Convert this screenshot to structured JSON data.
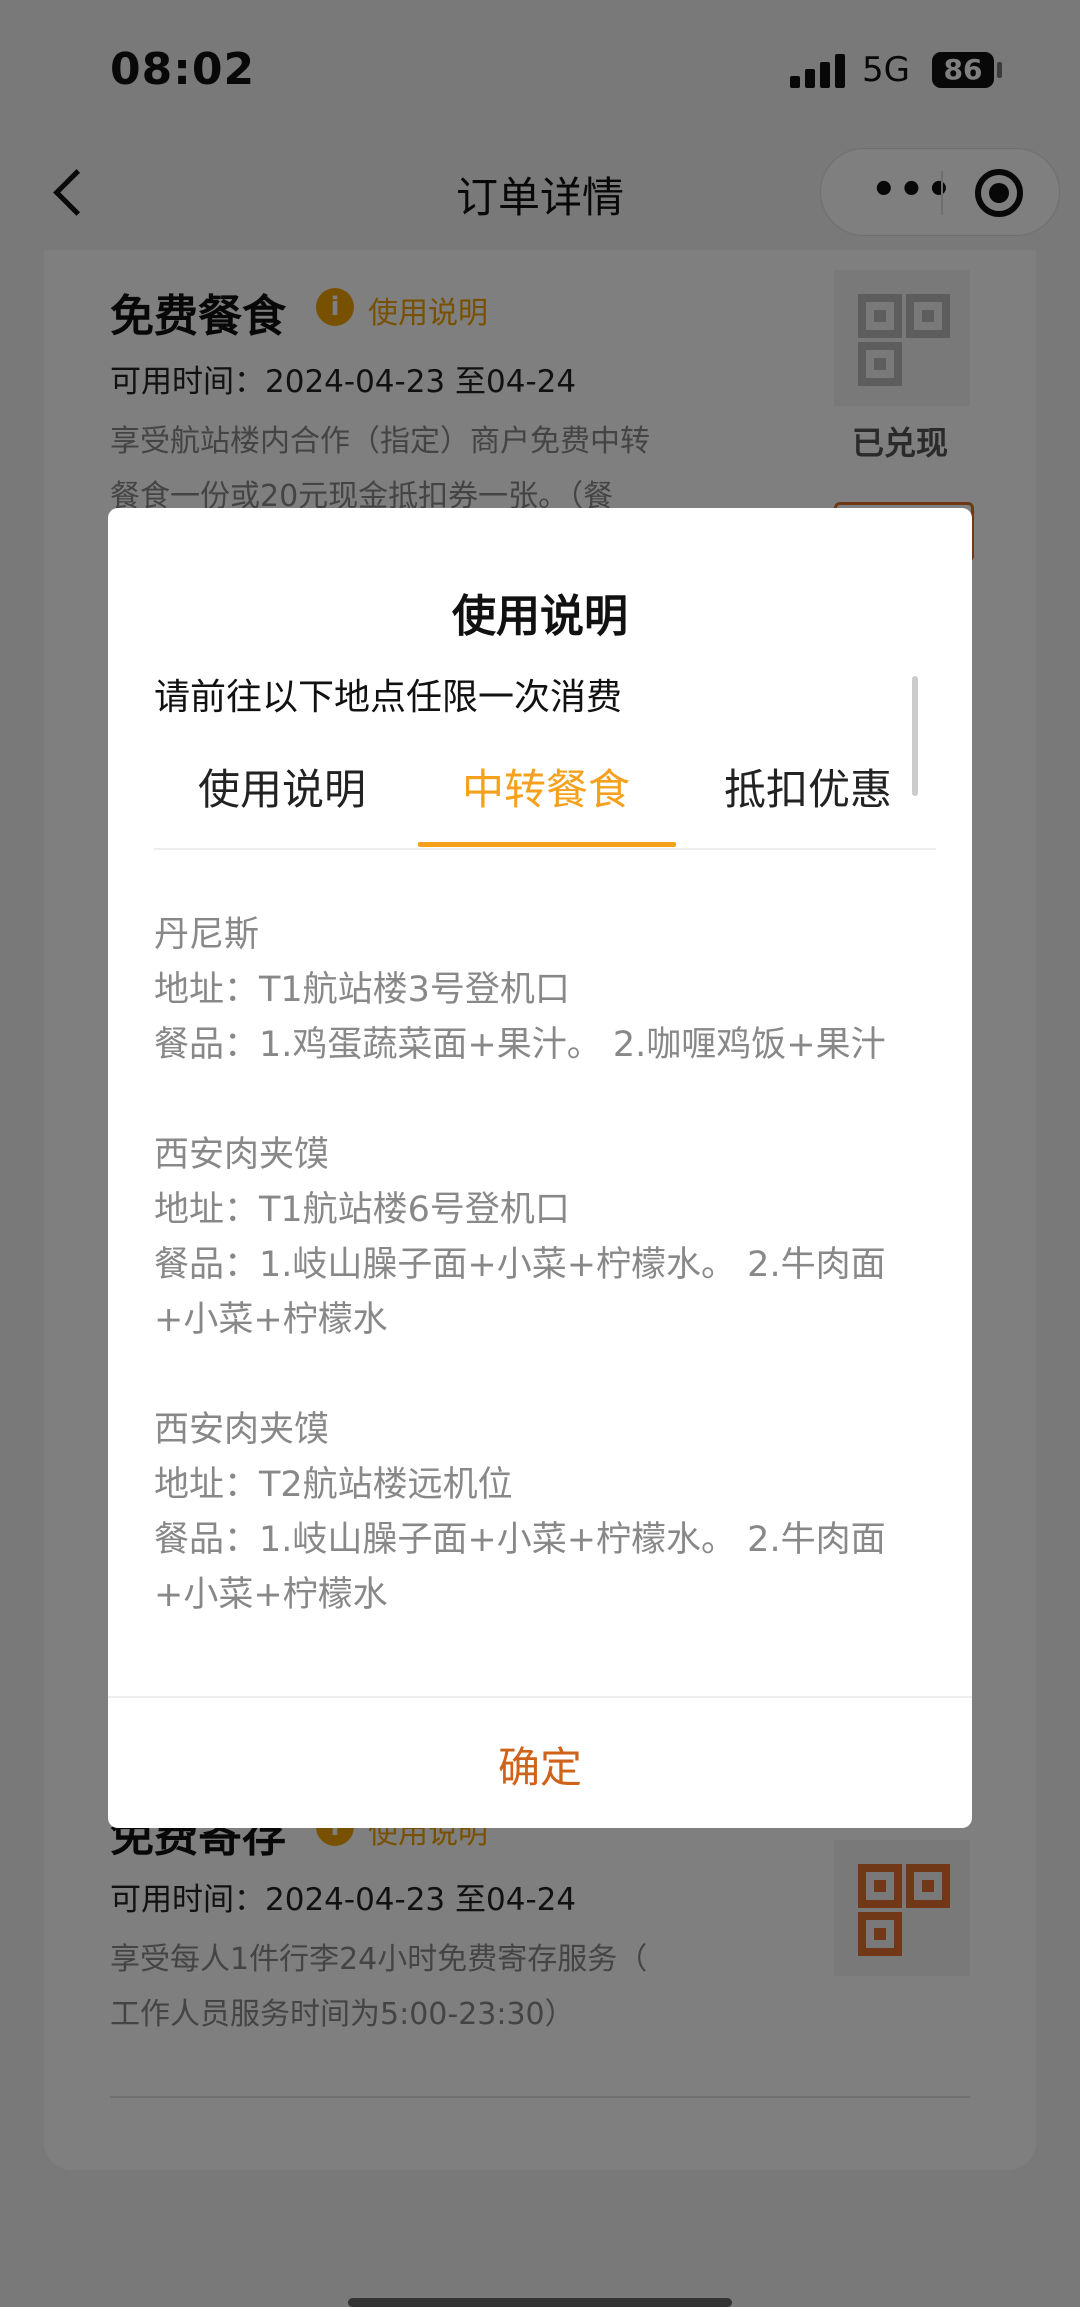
{
  "status_bar": {
    "time": "08:02",
    "network": "5G",
    "battery": "86"
  },
  "nav": {
    "title": "订单详情",
    "more_icon": "•••"
  },
  "sections": [
    {
      "title": "免费餐食",
      "info_icon": "i",
      "help_link": "使用说明",
      "time_label": "可用时间：",
      "time_range": "2024-04-23 至04-24",
      "desc_line1": "享受航站楼内合作（指定）商户免费中转",
      "desc_line2": "餐食一份或20元现金抵扣券一张。（餐",
      "status": "已兑现"
    },
    {
      "title": "免费寄存",
      "info_icon": "i",
      "help_link": "使用说明",
      "time_label": "可用时间：",
      "time_range": "2024-04-23 至04-24",
      "desc_line1": "享受每人1件行李24小时免费寄存服务（",
      "desc_line2": "工作人员服务时间为5:00-23:30）"
    }
  ],
  "modal": {
    "title": "使用说明",
    "subtitle": "请前往以下地点任限一次消费",
    "tabs": [
      "使用说明",
      "中转餐食",
      "抵扣优惠"
    ],
    "active_tab": 1,
    "entries": [
      {
        "name": "丹尼斯",
        "address": "地址：T1航站楼3号登机口",
        "items": "餐品：1.鸡蛋蔬菜面+果汁。 2.咖喱鸡饭+果汁"
      },
      {
        "name": "西安肉夹馍",
        "address": "地址：T1航站楼6号登机口",
        "items": "餐品：1.岐山臊子面+小菜+柠檬水。 2.牛肉面+小菜+柠檬水"
      },
      {
        "name": "西安肉夹馍",
        "address": "地址：T2航站楼远机位",
        "items": "餐品：1.岐山臊子面+小菜+柠檬水。 2.牛肉面+小菜+柠檬水"
      }
    ],
    "confirm_label": "确定"
  },
  "colors": {
    "accent": "#f5a11c",
    "confirm": "#d0631a",
    "qr_active": "#e0702c"
  }
}
